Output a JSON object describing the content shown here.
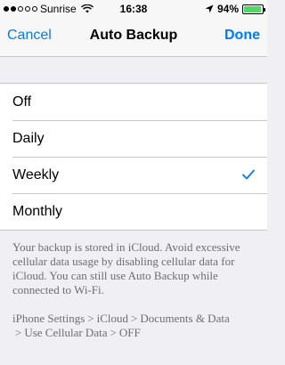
{
  "status_bar": {
    "carrier": "Sunrise",
    "time": "16:38",
    "battery_percent": "94%",
    "battery_level": 0.94,
    "signal_bars_filled": 2,
    "signal_bars_total": 5,
    "icons": [
      "signal-dots-icon",
      "wifi-icon",
      "location-arrow-icon",
      "battery-icon"
    ],
    "battery_color": "#4cd964"
  },
  "nav": {
    "cancel_label": "Cancel",
    "title": "Auto Backup",
    "done_label": "Done",
    "accent_color": "#007aff"
  },
  "options": [
    {
      "label": "Off",
      "selected": false
    },
    {
      "label": "Daily",
      "selected": false
    },
    {
      "label": "Weekly",
      "selected": true
    },
    {
      "label": "Monthly",
      "selected": false
    }
  ],
  "footer": {
    "description": "Your backup is stored in iCloud. Avoid excessive cellular data usage by disabling cellular data for iCloud. You can still use Auto Backup while connected to Wi-Fi.",
    "path": [
      "iPhone Settings",
      "iCloud",
      "Documents & Data",
      "Use Cellular Data",
      "OFF"
    ],
    "separator": ">"
  }
}
